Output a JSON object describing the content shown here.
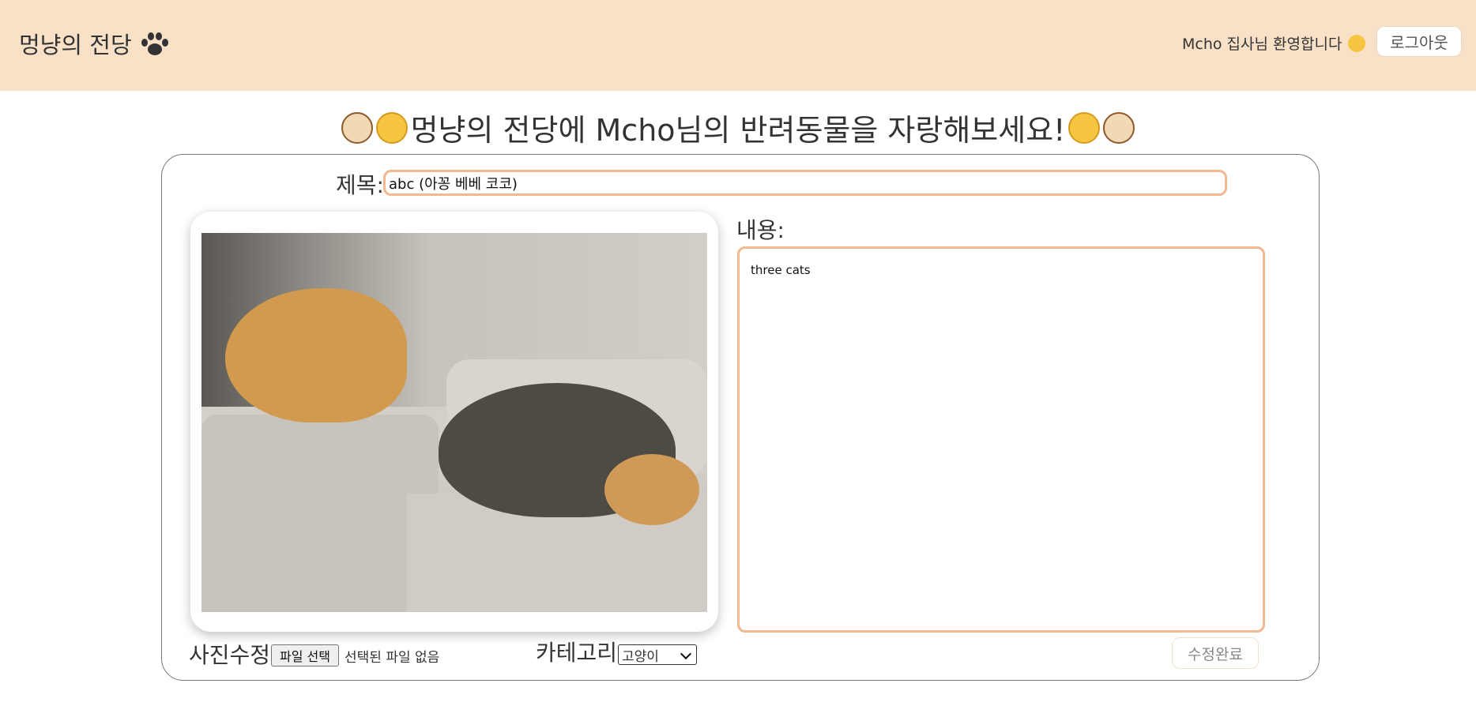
{
  "header": {
    "brand": "멍냥의 전당",
    "welcome": "Mcho 집사님 환영합니다",
    "logout_label": "로그아웃"
  },
  "main": {
    "heading": "멍냥의 전당에 Mcho님의 반려동물을 자랑해보세요!"
  },
  "form": {
    "title_label": "제목:",
    "title_value": "abc (아꽁 베베 코코)",
    "content_label": "내용:",
    "content_value": "three cats",
    "photo_label": "사진수정",
    "file_button_label": "파일 선택",
    "file_status": "선택된 파일 없음",
    "category_label": "카테고리",
    "category_selected": "고양이",
    "submit_label": "수정완료"
  },
  "colors": {
    "header_bg": "#f8e1c7",
    "input_border": "#f2b88f"
  },
  "icons": [
    "paw-icon",
    "dog-emoji-icon",
    "cat-face-icon",
    "chevron-down-icon"
  ]
}
